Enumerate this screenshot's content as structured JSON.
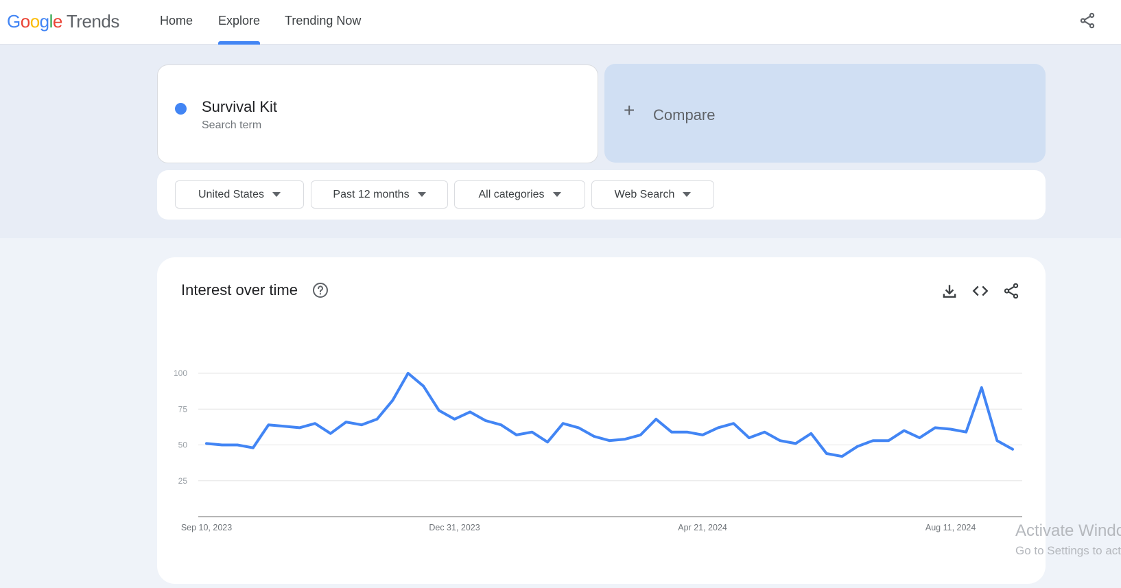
{
  "header": {
    "logo": {
      "google": [
        "G",
        "o",
        "o",
        "g",
        "l",
        "e"
      ],
      "product": "Trends"
    },
    "nav": [
      {
        "label": "Home",
        "active": false
      },
      {
        "label": "Explore",
        "active": true
      },
      {
        "label": "Trending Now",
        "active": false
      }
    ],
    "share_icon": "share-icon"
  },
  "search": {
    "term": "Survival Kit",
    "term_type": "Search term",
    "term_color": "#4285f4",
    "compare_label": "Compare",
    "compare_icon": "+"
  },
  "filters": [
    {
      "label": "United States"
    },
    {
      "label": "Past 12 months"
    },
    {
      "label": "All categories"
    },
    {
      "label": "Web Search"
    }
  ],
  "chart_panel": {
    "title": "Interest over time",
    "actions": [
      "download-icon",
      "embed-code-icon",
      "share-icon"
    ]
  },
  "chart_data": {
    "type": "line",
    "title": "Interest over time",
    "xlabel": "",
    "ylabel": "",
    "ylim": [
      0,
      100
    ],
    "yticks": [
      25,
      50,
      75,
      100
    ],
    "grid": true,
    "x_tick_labels": [
      "Sep 10, 2023",
      "Dec 31, 2023",
      "Apr 21, 2024",
      "Aug 11, 2024"
    ],
    "x_tick_indices": [
      0,
      16,
      32,
      48
    ],
    "series": [
      {
        "name": "Survival Kit",
        "color": "#4285f4",
        "values": [
          51,
          50,
          50,
          48,
          64,
          63,
          62,
          65,
          58,
          66,
          64,
          68,
          81,
          100,
          91,
          74,
          68,
          73,
          67,
          64,
          57,
          59,
          52,
          65,
          62,
          56,
          53,
          54,
          57,
          68,
          59,
          59,
          57,
          62,
          65,
          55,
          59,
          53,
          51,
          58,
          44,
          42,
          49,
          53,
          53,
          60,
          55,
          62,
          61,
          59,
          90,
          53,
          47
        ]
      }
    ]
  },
  "watermark": {
    "line1": "Activate Windows",
    "line2": "Go to Settings to activate Windows."
  }
}
